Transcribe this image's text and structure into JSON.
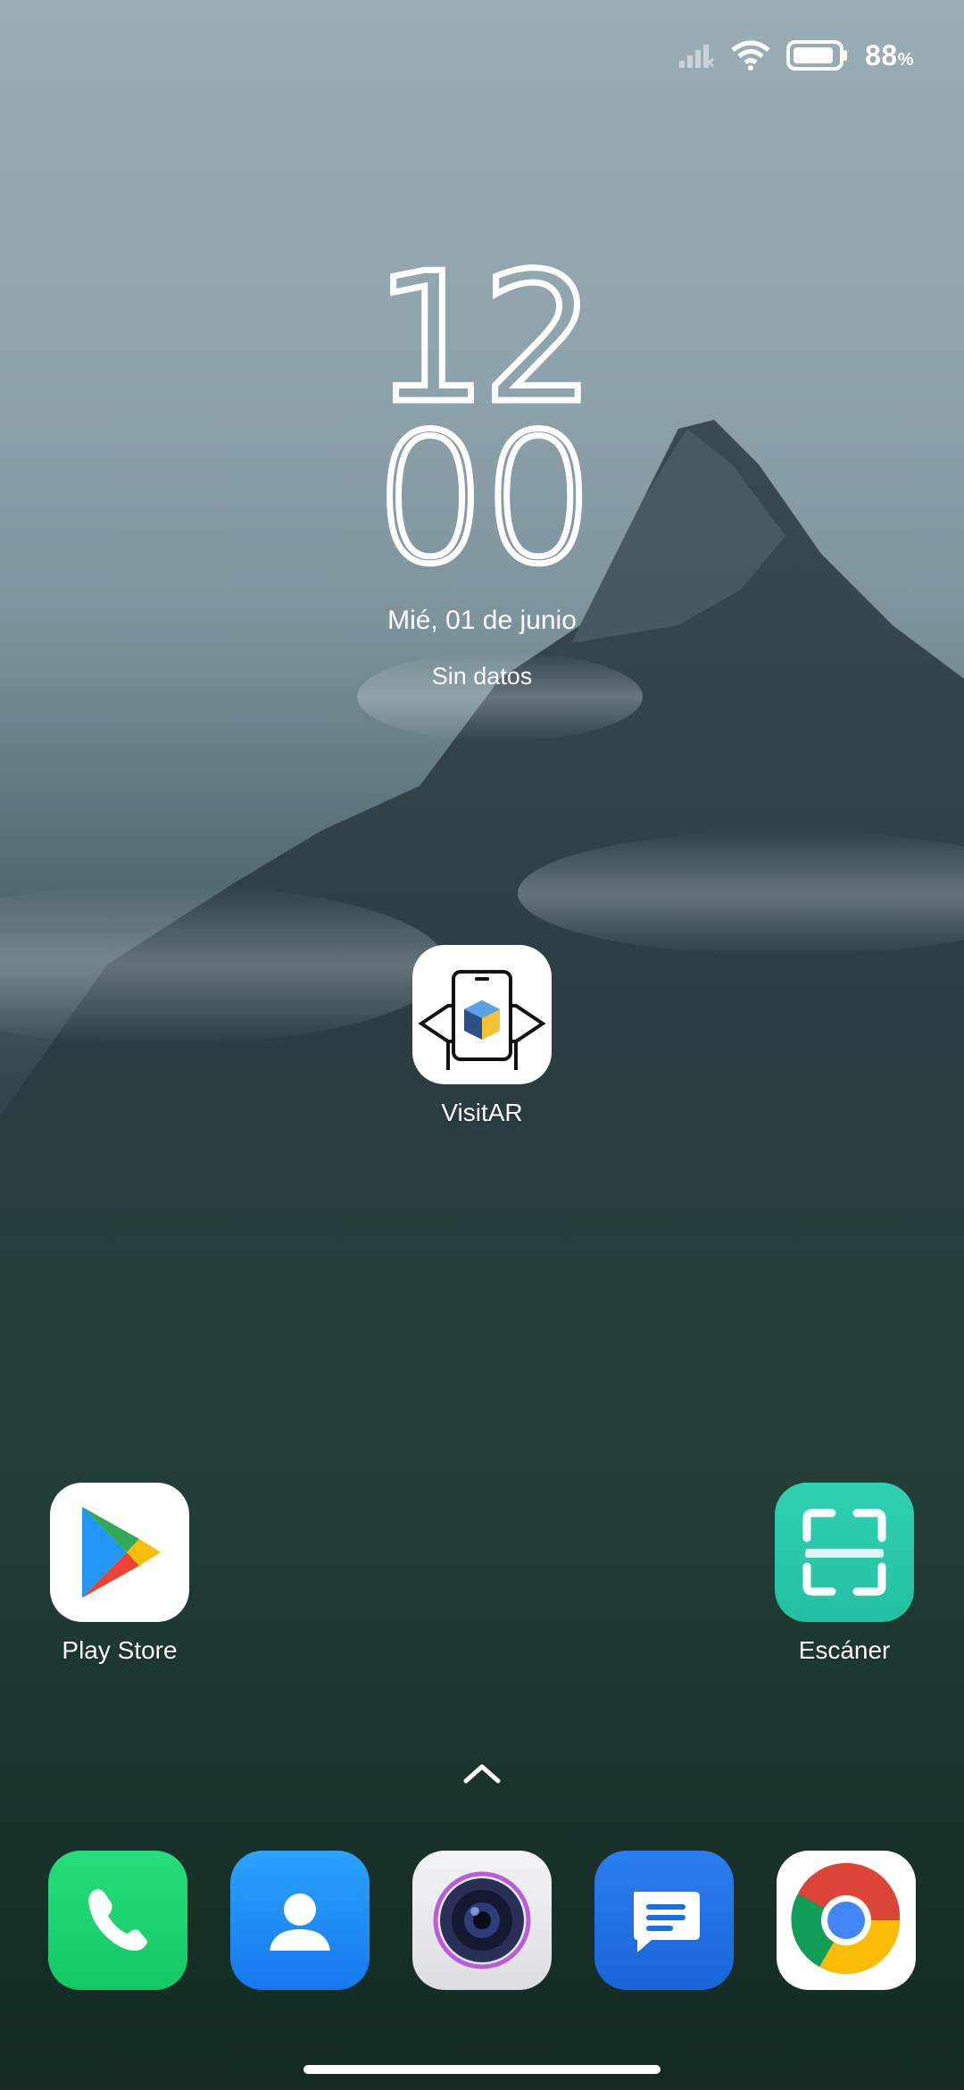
{
  "status_bar": {
    "battery_percent": "88",
    "battery_unit": "%"
  },
  "clock": {
    "hours": "12",
    "minutes": "00"
  },
  "date": "Mié, 01 de junio",
  "weather": "Sin datos",
  "apps": {
    "visitar": {
      "label": "VisitAR"
    },
    "play_store": {
      "label": "Play Store"
    },
    "escaner": {
      "label": "Escáner"
    }
  },
  "dock": [
    "phone-icon",
    "contacts-icon",
    "camera-icon",
    "messages-icon",
    "chrome-icon"
  ],
  "colors": {
    "phone": "#1fd36f",
    "contacts": "#1c8cf5",
    "messages": "#1a73e8",
    "escaner": "#2ccca8"
  }
}
